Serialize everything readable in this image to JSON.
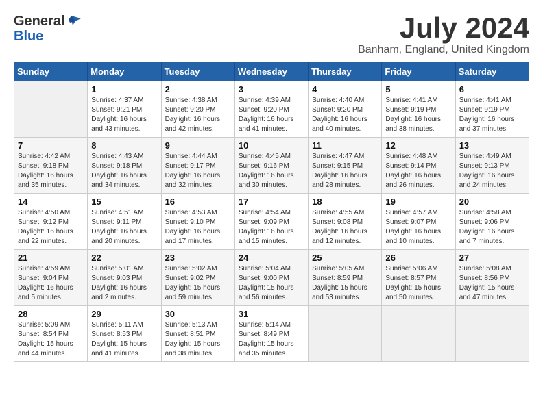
{
  "logo": {
    "general": "General",
    "blue": "Blue"
  },
  "title": "July 2024",
  "location": "Banham, England, United Kingdom",
  "headers": [
    "Sunday",
    "Monday",
    "Tuesday",
    "Wednesday",
    "Thursday",
    "Friday",
    "Saturday"
  ],
  "weeks": [
    [
      {
        "day": "",
        "sunrise": "",
        "sunset": "",
        "daylight": ""
      },
      {
        "day": "1",
        "sunrise": "Sunrise: 4:37 AM",
        "sunset": "Sunset: 9:21 PM",
        "daylight": "Daylight: 16 hours and 43 minutes."
      },
      {
        "day": "2",
        "sunrise": "Sunrise: 4:38 AM",
        "sunset": "Sunset: 9:20 PM",
        "daylight": "Daylight: 16 hours and 42 minutes."
      },
      {
        "day": "3",
        "sunrise": "Sunrise: 4:39 AM",
        "sunset": "Sunset: 9:20 PM",
        "daylight": "Daylight: 16 hours and 41 minutes."
      },
      {
        "day": "4",
        "sunrise": "Sunrise: 4:40 AM",
        "sunset": "Sunset: 9:20 PM",
        "daylight": "Daylight: 16 hours and 40 minutes."
      },
      {
        "day": "5",
        "sunrise": "Sunrise: 4:41 AM",
        "sunset": "Sunset: 9:19 PM",
        "daylight": "Daylight: 16 hours and 38 minutes."
      },
      {
        "day": "6",
        "sunrise": "Sunrise: 4:41 AM",
        "sunset": "Sunset: 9:19 PM",
        "daylight": "Daylight: 16 hours and 37 minutes."
      }
    ],
    [
      {
        "day": "7",
        "sunrise": "Sunrise: 4:42 AM",
        "sunset": "Sunset: 9:18 PM",
        "daylight": "Daylight: 16 hours and 35 minutes."
      },
      {
        "day": "8",
        "sunrise": "Sunrise: 4:43 AM",
        "sunset": "Sunset: 9:18 PM",
        "daylight": "Daylight: 16 hours and 34 minutes."
      },
      {
        "day": "9",
        "sunrise": "Sunrise: 4:44 AM",
        "sunset": "Sunset: 9:17 PM",
        "daylight": "Daylight: 16 hours and 32 minutes."
      },
      {
        "day": "10",
        "sunrise": "Sunrise: 4:45 AM",
        "sunset": "Sunset: 9:16 PM",
        "daylight": "Daylight: 16 hours and 30 minutes."
      },
      {
        "day": "11",
        "sunrise": "Sunrise: 4:47 AM",
        "sunset": "Sunset: 9:15 PM",
        "daylight": "Daylight: 16 hours and 28 minutes."
      },
      {
        "day": "12",
        "sunrise": "Sunrise: 4:48 AM",
        "sunset": "Sunset: 9:14 PM",
        "daylight": "Daylight: 16 hours and 26 minutes."
      },
      {
        "day": "13",
        "sunrise": "Sunrise: 4:49 AM",
        "sunset": "Sunset: 9:13 PM",
        "daylight": "Daylight: 16 hours and 24 minutes."
      }
    ],
    [
      {
        "day": "14",
        "sunrise": "Sunrise: 4:50 AM",
        "sunset": "Sunset: 9:12 PM",
        "daylight": "Daylight: 16 hours and 22 minutes."
      },
      {
        "day": "15",
        "sunrise": "Sunrise: 4:51 AM",
        "sunset": "Sunset: 9:11 PM",
        "daylight": "Daylight: 16 hours and 20 minutes."
      },
      {
        "day": "16",
        "sunrise": "Sunrise: 4:53 AM",
        "sunset": "Sunset: 9:10 PM",
        "daylight": "Daylight: 16 hours and 17 minutes."
      },
      {
        "day": "17",
        "sunrise": "Sunrise: 4:54 AM",
        "sunset": "Sunset: 9:09 PM",
        "daylight": "Daylight: 16 hours and 15 minutes."
      },
      {
        "day": "18",
        "sunrise": "Sunrise: 4:55 AM",
        "sunset": "Sunset: 9:08 PM",
        "daylight": "Daylight: 16 hours and 12 minutes."
      },
      {
        "day": "19",
        "sunrise": "Sunrise: 4:57 AM",
        "sunset": "Sunset: 9:07 PM",
        "daylight": "Daylight: 16 hours and 10 minutes."
      },
      {
        "day": "20",
        "sunrise": "Sunrise: 4:58 AM",
        "sunset": "Sunset: 9:06 PM",
        "daylight": "Daylight: 16 hours and 7 minutes."
      }
    ],
    [
      {
        "day": "21",
        "sunrise": "Sunrise: 4:59 AM",
        "sunset": "Sunset: 9:04 PM",
        "daylight": "Daylight: 16 hours and 5 minutes."
      },
      {
        "day": "22",
        "sunrise": "Sunrise: 5:01 AM",
        "sunset": "Sunset: 9:03 PM",
        "daylight": "Daylight: 16 hours and 2 minutes."
      },
      {
        "day": "23",
        "sunrise": "Sunrise: 5:02 AM",
        "sunset": "Sunset: 9:02 PM",
        "daylight": "Daylight: 15 hours and 59 minutes."
      },
      {
        "day": "24",
        "sunrise": "Sunrise: 5:04 AM",
        "sunset": "Sunset: 9:00 PM",
        "daylight": "Daylight: 15 hours and 56 minutes."
      },
      {
        "day": "25",
        "sunrise": "Sunrise: 5:05 AM",
        "sunset": "Sunset: 8:59 PM",
        "daylight": "Daylight: 15 hours and 53 minutes."
      },
      {
        "day": "26",
        "sunrise": "Sunrise: 5:06 AM",
        "sunset": "Sunset: 8:57 PM",
        "daylight": "Daylight: 15 hours and 50 minutes."
      },
      {
        "day": "27",
        "sunrise": "Sunrise: 5:08 AM",
        "sunset": "Sunset: 8:56 PM",
        "daylight": "Daylight: 15 hours and 47 minutes."
      }
    ],
    [
      {
        "day": "28",
        "sunrise": "Sunrise: 5:09 AM",
        "sunset": "Sunset: 8:54 PM",
        "daylight": "Daylight: 15 hours and 44 minutes."
      },
      {
        "day": "29",
        "sunrise": "Sunrise: 5:11 AM",
        "sunset": "Sunset: 8:53 PM",
        "daylight": "Daylight: 15 hours and 41 minutes."
      },
      {
        "day": "30",
        "sunrise": "Sunrise: 5:13 AM",
        "sunset": "Sunset: 8:51 PM",
        "daylight": "Daylight: 15 hours and 38 minutes."
      },
      {
        "day": "31",
        "sunrise": "Sunrise: 5:14 AM",
        "sunset": "Sunset: 8:49 PM",
        "daylight": "Daylight: 15 hours and 35 minutes."
      },
      {
        "day": "",
        "sunrise": "",
        "sunset": "",
        "daylight": ""
      },
      {
        "day": "",
        "sunrise": "",
        "sunset": "",
        "daylight": ""
      },
      {
        "day": "",
        "sunrise": "",
        "sunset": "",
        "daylight": ""
      }
    ]
  ]
}
